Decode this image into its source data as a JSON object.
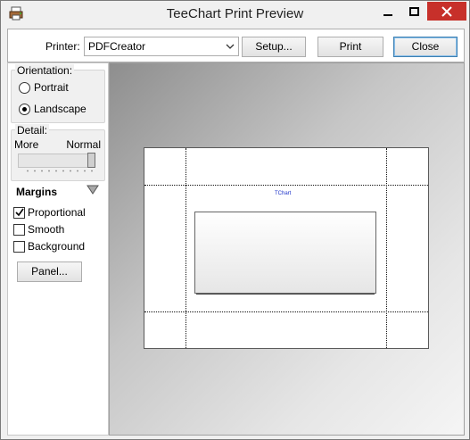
{
  "window": {
    "title": "TeeChart Print Preview",
    "app_icon": "printer-app-icon",
    "controls": [
      "minimize-icon",
      "maximize-icon",
      "close-icon"
    ],
    "close_color": "#c7302a"
  },
  "toolbar": {
    "printer_label": "Printer:",
    "printer_value": "PDFCreator",
    "setup_label": "Setup...",
    "print_label": "Print",
    "close_label": "Close"
  },
  "sidebar": {
    "orientation": {
      "label": "Orientation:",
      "options": [
        "Portrait",
        "Landscape"
      ],
      "selected": "Landscape"
    },
    "detail": {
      "label": "Detail:",
      "min_label": "More",
      "max_label": "Normal",
      "level": 1.0
    },
    "margins": {
      "label": "Margins",
      "proportional_label": "Proportional",
      "proportional_checked": true,
      "smooth_label": "Smooth",
      "smooth_checked": false,
      "background_label": "Background",
      "background_checked": false
    },
    "panel_button_label": "Panel..."
  },
  "preview": {
    "chart_title": "TChart"
  }
}
